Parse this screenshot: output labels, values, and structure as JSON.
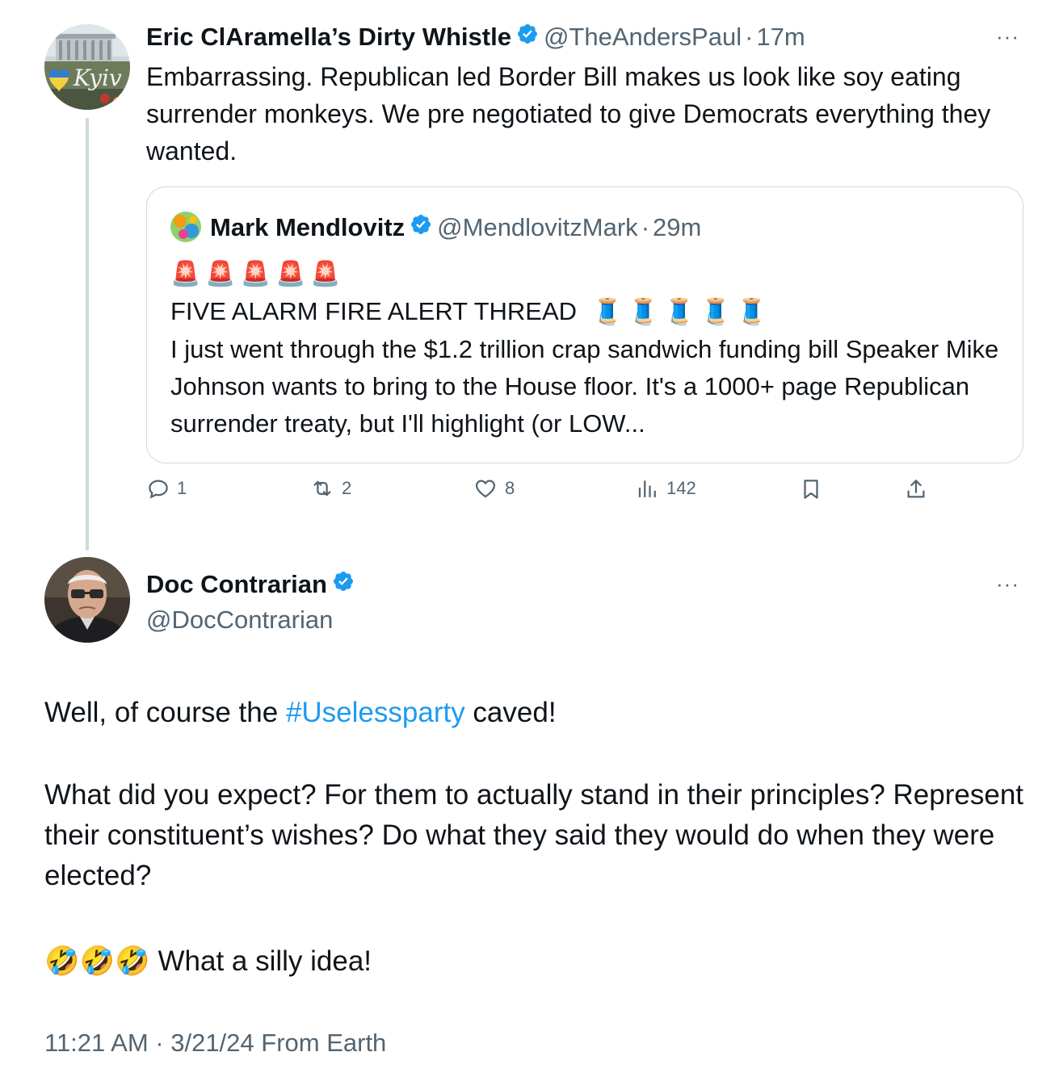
{
  "tweet1": {
    "display_name": "Eric ClAramella’s Dirty Whistle",
    "handle": "@TheAndersPaul",
    "sep": "·",
    "time": "17m",
    "text": "Embarrassing. Republican led Border Bill makes us look like soy eating surrender monkeys. We pre negotiated to give Democrats everything they wanted.",
    "avatar_text": "Kyiv",
    "more_label": "···"
  },
  "quote": {
    "display_name": "Mark Mendlovitz",
    "handle": "@MendlovitzMark",
    "sep": "·",
    "time": "29m",
    "alarm_row": "🚨🚨🚨🚨🚨",
    "line_title": "FIVE ALARM FIRE ALERT THREAD",
    "thread_row": "🧵🧵🧵🧵🧵",
    "text": "I just went through the $1.2 trillion crap sandwich funding bill Speaker Mike Johnson wants to bring to the House floor. It's a 1000+ page Republican surrender treaty, but I'll highlight (or LOW..."
  },
  "actions": {
    "reply_count": "1",
    "retweet_count": "2",
    "like_count": "8",
    "view_count": "142"
  },
  "tweet2": {
    "display_name": "Doc Contrarian",
    "handle": "@DocContrarian",
    "more_label": "···",
    "text_prefix": "Well, of course the ",
    "hashtag": "#Uselessparty",
    "text_suffix": " caved!",
    "paragraph2": "What did you expect? For them to actually stand in their principles? Represent their constituent’s wishes? Do what they said they would do when they were elected?",
    "laugh_emojis": "🤣🤣🤣",
    "closing": " What a silly idea!",
    "timestamp": "11:21 AM · 3/21/24 From Earth"
  },
  "colors": {
    "verified": "#1d9bf0",
    "hashtag": "#1d9bf0",
    "secondary_text": "#536471",
    "border": "#cfd9de"
  }
}
